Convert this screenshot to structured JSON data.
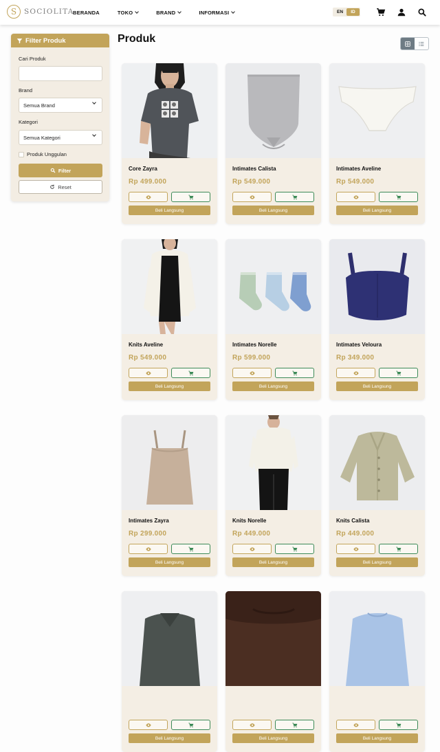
{
  "brand": {
    "name": "SOCIOLITA",
    "mark": "S"
  },
  "nav": [
    {
      "label": "BERANDA",
      "dropdown": false
    },
    {
      "label": "TOKO",
      "dropdown": true
    },
    {
      "label": "BRAND",
      "dropdown": true
    },
    {
      "label": "INFORMASI",
      "dropdown": true
    }
  ],
  "lang": {
    "options": [
      "EN",
      "ID"
    ],
    "selected": "ID"
  },
  "header_icons": [
    "cart-icon",
    "user-icon",
    "search-icon"
  ],
  "filter": {
    "title": "Filter Produk",
    "search_label": "Cari Produk",
    "search_value": "",
    "brand_label": "Brand",
    "brand_value": "Semua Brand",
    "category_label": "Kategori",
    "category_value": "Semua Kategori",
    "featured_label": "Produk Unggulan",
    "featured_checked": false,
    "filter_button": "Filter",
    "reset_button": "Reset"
  },
  "main": {
    "title": "Produk",
    "view": "grid"
  },
  "buy_label": "Beli Langsung",
  "colors": {
    "accent": "#c2a45a",
    "cart_green": "#3c8a57",
    "card_bg": "#f4eee4"
  },
  "products": [
    {
      "name": "Core Zayra",
      "price": "Rp 499.000"
    },
    {
      "name": "Intimates Calista",
      "price": "Rp 549.000"
    },
    {
      "name": "Intimates Aveline",
      "price": "Rp 549.000"
    },
    {
      "name": "Knits Aveline",
      "price": "Rp 549.000"
    },
    {
      "name": "Intimates Norelle",
      "price": "Rp 599.000"
    },
    {
      "name": "Intimates Veloura",
      "price": "Rp 349.000"
    },
    {
      "name": "Intimates Zayra",
      "price": "Rp 299.000"
    },
    {
      "name": "Knits Norelle",
      "price": "Rp 449.000"
    },
    {
      "name": "Knits Calista",
      "price": "Rp 449.000"
    },
    {
      "name": "",
      "price": ""
    },
    {
      "name": "",
      "price": ""
    },
    {
      "name": "",
      "price": ""
    }
  ]
}
